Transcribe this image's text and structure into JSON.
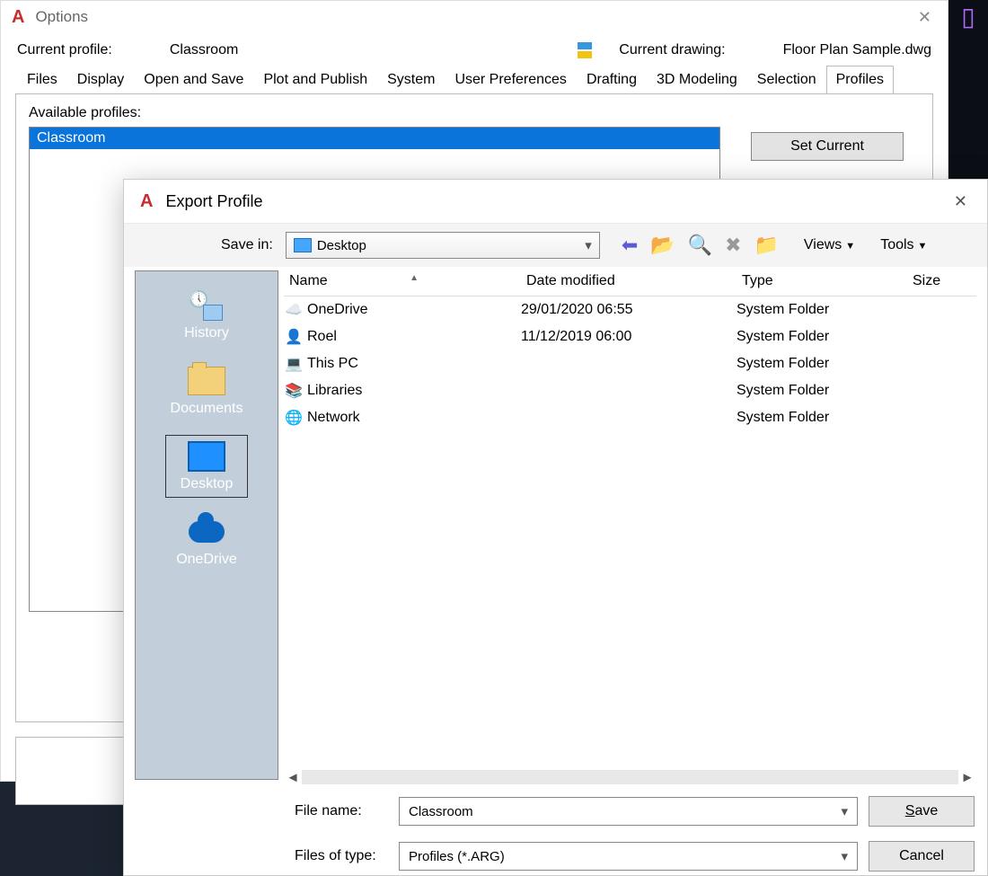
{
  "options": {
    "title": "Options",
    "profile_label": "Current profile:",
    "profile_value": "Classroom",
    "drawing_label": "Current drawing:",
    "drawing_value": "Floor Plan Sample.dwg",
    "tabs": [
      "Files",
      "Display",
      "Open and Save",
      "Plot and Publish",
      "System",
      "User Preferences",
      "Drafting",
      "3D Modeling",
      "Selection",
      "Profiles"
    ],
    "active_tab_index": 9,
    "available_label": "Available profiles:",
    "profiles": [
      "Classroom"
    ],
    "set_current": "Set Current"
  },
  "export": {
    "title": "Export Profile",
    "save_in_label": "Save in:",
    "save_in_value": "Desktop",
    "menus": {
      "views": "Views",
      "tools": "Tools"
    },
    "places": [
      {
        "key": "history",
        "label": "History"
      },
      {
        "key": "documents",
        "label": "Documents"
      },
      {
        "key": "desktop",
        "label": "Desktop",
        "selected": true
      },
      {
        "key": "onedrive",
        "label": "OneDrive"
      }
    ],
    "columns": {
      "name": "Name",
      "date": "Date modified",
      "type": "Type",
      "size": "Size"
    },
    "files": [
      {
        "icon": "cloud",
        "name": "OneDrive",
        "date": "29/01/2020 06:55",
        "type": "System Folder"
      },
      {
        "icon": "user",
        "name": "Roel",
        "date": "11/12/2019 06:00",
        "type": "System Folder"
      },
      {
        "icon": "pc",
        "name": "This PC",
        "date": "",
        "type": "System Folder"
      },
      {
        "icon": "lib",
        "name": "Libraries",
        "date": "",
        "type": "System Folder"
      },
      {
        "icon": "net",
        "name": "Network",
        "date": "",
        "type": "System Folder"
      }
    ],
    "file_name_label": "File name:",
    "file_name_value": "Classroom",
    "file_type_label": "Files of type:",
    "file_type_value": "Profiles (*.ARG)",
    "save": "Save",
    "cancel": "Cancel"
  }
}
